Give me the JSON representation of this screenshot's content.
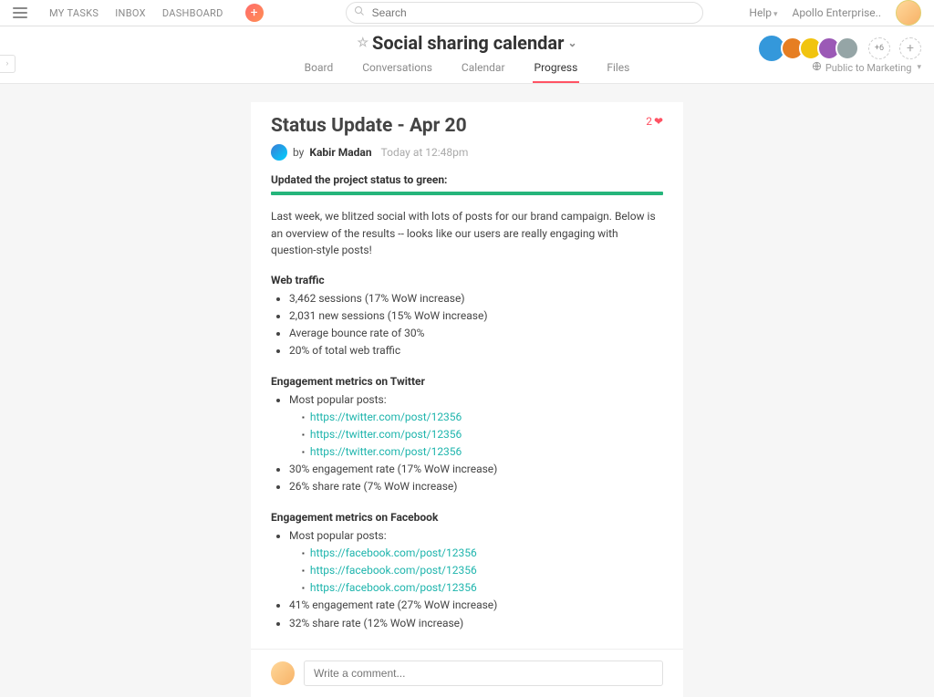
{
  "topbar": {
    "nav": {
      "my_tasks": "MY TASKS",
      "inbox": "INBOX",
      "dashboard": "DASHBOARD"
    },
    "search_placeholder": "Search",
    "help": "Help",
    "org": "Apollo Enterprise.."
  },
  "project": {
    "title": "Social sharing calendar",
    "tabs": {
      "board": "Board",
      "conversations": "Conversations",
      "calendar": "Calendar",
      "progress": "Progress",
      "files": "Files"
    },
    "active_tab": "progress",
    "visibility": "Public to Marketing",
    "member_overflow": "+6",
    "member_colors": [
      "#3498db",
      "#e67e22",
      "#f1c40f",
      "#9b59b6",
      "#95a5a6"
    ]
  },
  "post": {
    "title": "Status Update - Apr 20",
    "likes": "2",
    "by_prefix": "by",
    "author": "Kabir Madan",
    "timestamp": "Today at 12:48pm",
    "status_heading": "Updated the project status to green:",
    "intro": "Last week, we blitzed social with lots of posts for our brand campaign. Below is an overview of the results -- looks like our users are really engaging with question-style posts!",
    "sections": {
      "web": {
        "heading": "Web traffic",
        "items": [
          "3,462 sessions (17% WoW increase)",
          "2,031 new sessions (15% WoW increase)",
          "Average bounce rate of 30%",
          "20% of total web traffic"
        ]
      },
      "twitter": {
        "heading": "Engagement metrics on Twitter",
        "lead": "Most popular posts:",
        "links": [
          "https://twitter.com/post/12356",
          "https://twitter.com/post/12356",
          "https://twitter.com/post/12356"
        ],
        "tail": [
          "30% engagement rate (17% WoW increase)",
          "26% share rate (7% WoW increase)"
        ]
      },
      "facebook": {
        "heading": "Engagement metrics on Facebook",
        "lead": "Most popular posts:",
        "links": [
          "https://facebook.com/post/12356",
          "https://facebook.com/post/12356",
          "https://facebook.com/post/12356"
        ],
        "tail": [
          "41% engagement rate (27% WoW increase)",
          "32% share rate (12% WoW increase)"
        ]
      }
    }
  },
  "composer": {
    "placeholder": "Write a comment..."
  }
}
